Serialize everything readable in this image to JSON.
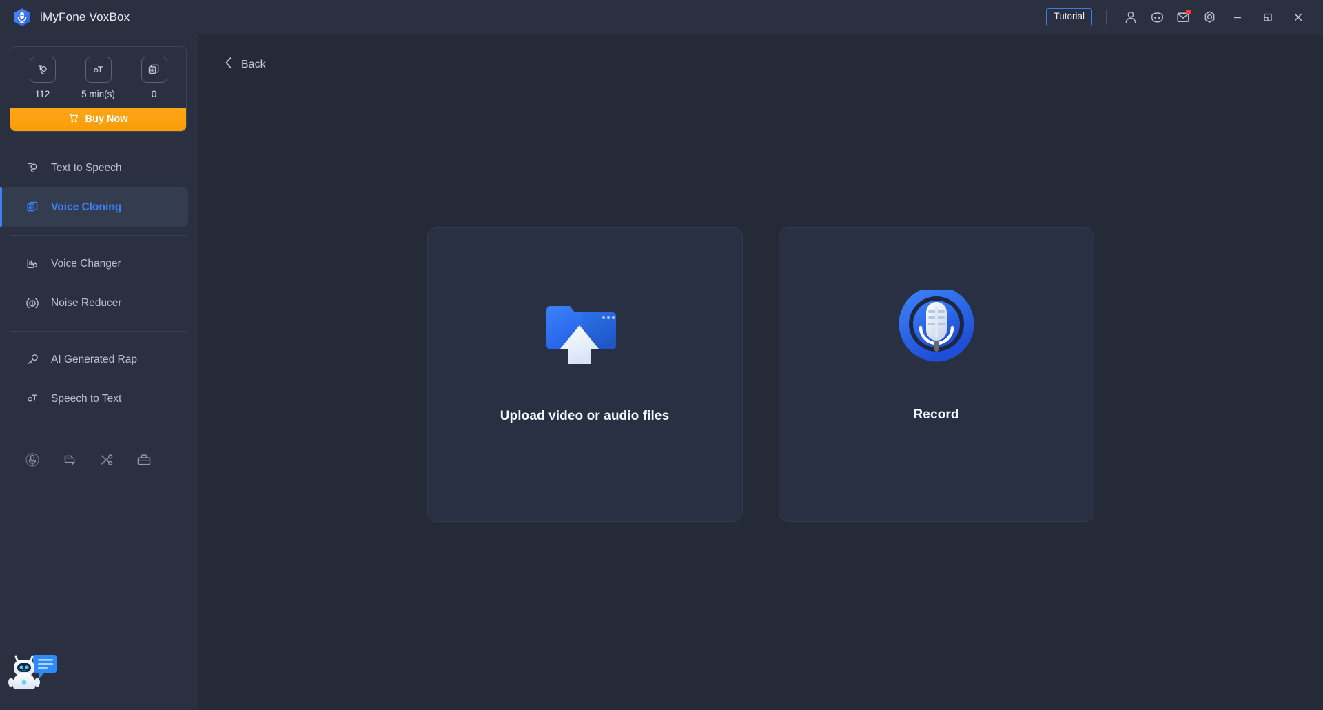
{
  "app": {
    "title": "iMyFone VoxBox",
    "logo_icon": "microphone-hexagon-logo"
  },
  "titlebar": {
    "tutorial_label": "Tutorial",
    "icons": [
      {
        "name": "account-icon",
        "glyph": "person"
      },
      {
        "name": "discord-icon",
        "glyph": "discord"
      },
      {
        "name": "mail-icon",
        "glyph": "mail",
        "badge": true
      },
      {
        "name": "settings-icon",
        "glyph": "gear"
      }
    ],
    "window_controls": [
      {
        "name": "minimize-button",
        "glyph": "minimize"
      },
      {
        "name": "maximize-button",
        "glyph": "maximize"
      },
      {
        "name": "close-button",
        "glyph": "close"
      }
    ]
  },
  "sidebar": {
    "credits": [
      {
        "name": "characters-credit",
        "icon": "text-to-speech-icon",
        "value": "112"
      },
      {
        "name": "minutes-credit",
        "icon": "speech-to-text-icon",
        "value": "5 min(s)"
      },
      {
        "name": "clones-credit",
        "icon": "voice-cloning-icon",
        "value": "0"
      }
    ],
    "buy_now_label": "Buy Now",
    "nav_items": [
      {
        "name": "sidebar-item-text-to-speech",
        "label": "Text to Speech",
        "icon": "text-to-speech-icon",
        "active": false
      },
      {
        "name": "sidebar-item-voice-cloning",
        "label": "Voice Cloning",
        "icon": "voice-cloning-icon",
        "active": true
      },
      {
        "name": "sidebar-item-voice-changer",
        "label": "Voice Changer",
        "icon": "voice-changer-icon",
        "active": false
      },
      {
        "name": "sidebar-item-noise-reducer",
        "label": "Noise Reducer",
        "icon": "noise-reducer-icon",
        "active": false
      },
      {
        "name": "sidebar-item-ai-generated-rap",
        "label": "AI Generated Rap",
        "icon": "ai-rap-icon",
        "active": false
      },
      {
        "name": "sidebar-item-speech-to-text",
        "label": "Speech to Text",
        "icon": "speech-to-text-icon",
        "active": false
      }
    ],
    "tools": [
      {
        "name": "recorder-tool-icon",
        "glyph": "microphone"
      },
      {
        "name": "converter-tool-icon",
        "glyph": "loop"
      },
      {
        "name": "cutter-tool-icon",
        "glyph": "scissors"
      },
      {
        "name": "toolbox-tool-icon",
        "glyph": "toolbox"
      }
    ],
    "chatbot_icon": "chatbot-assistant-icon"
  },
  "main": {
    "back_label": "Back",
    "cards": [
      {
        "name": "upload-files-card",
        "label": "Upload video or audio files",
        "icon": "folder-upload-icon"
      },
      {
        "name": "record-card",
        "label": "Record",
        "icon": "microphone-record-icon"
      }
    ]
  },
  "colors": {
    "accent_blue": "#3b82f6",
    "buy_now_orange": "#fb9d09",
    "titlebar_bg": "#2a3040",
    "sidebar_bg": "#2a3040",
    "main_bg": "#252a38",
    "card_bg": "#2a3043",
    "badge_red": "#ff3b30"
  }
}
